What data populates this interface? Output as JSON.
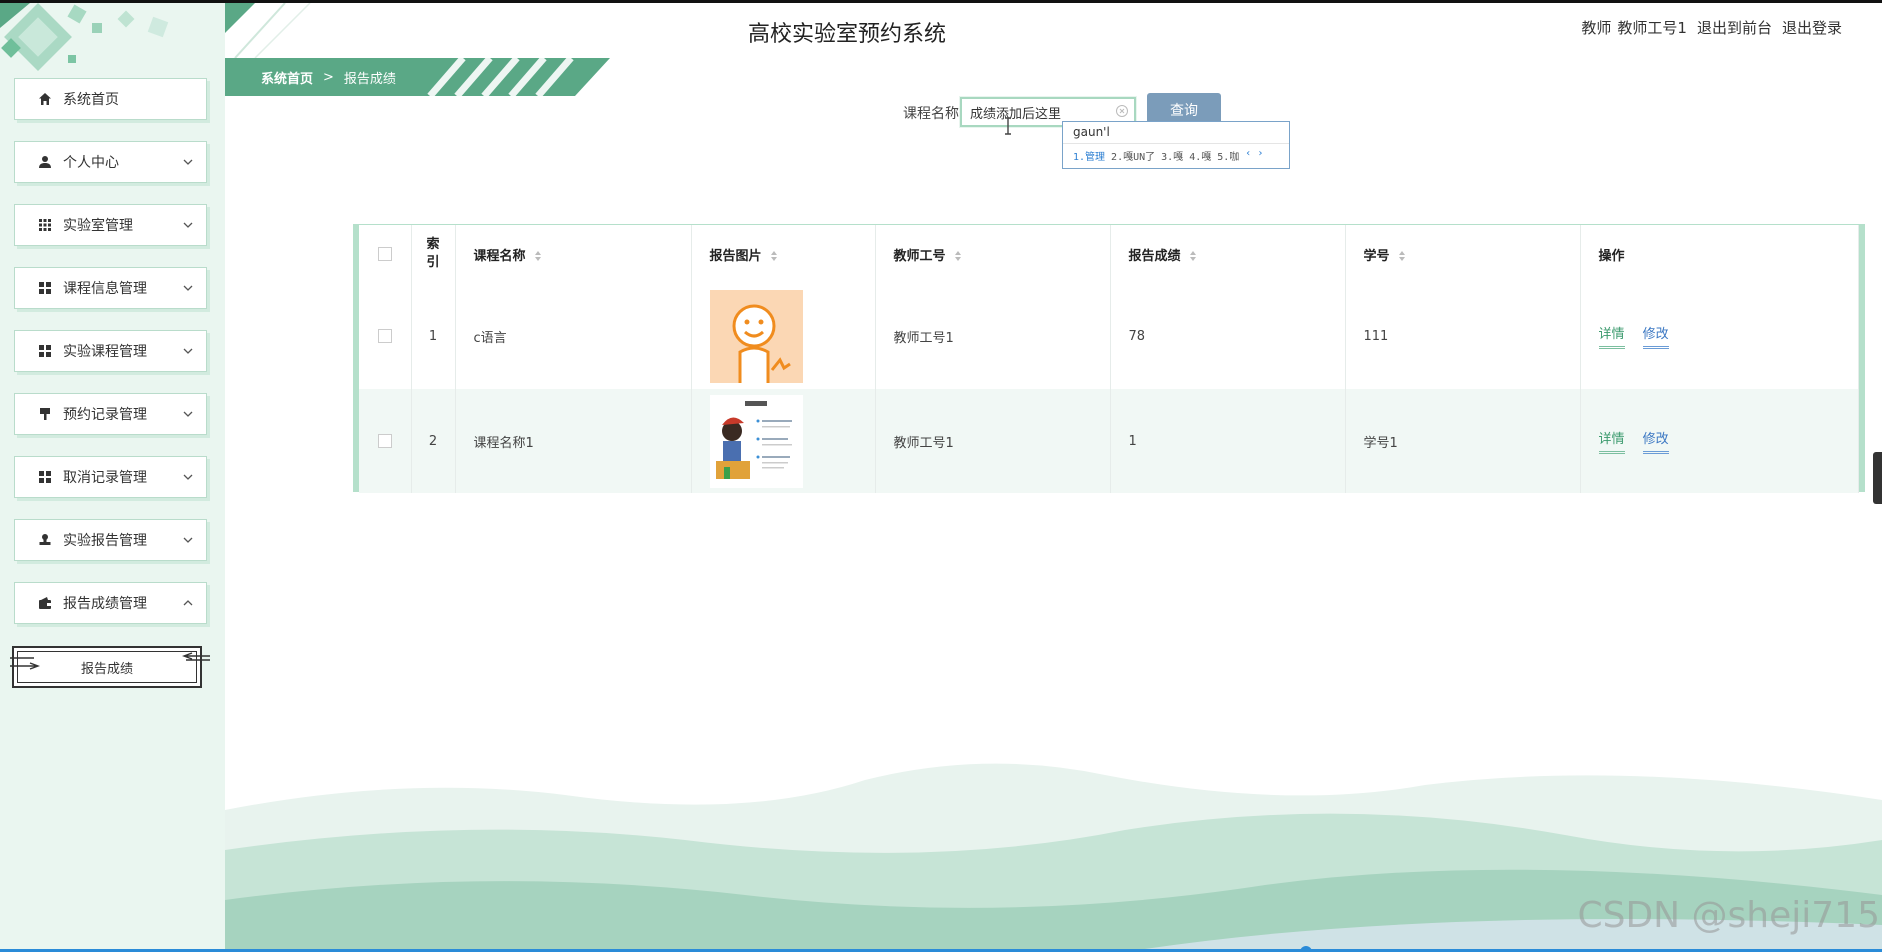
{
  "header": {
    "title": "高校实验室预约系统",
    "user_role": "教师",
    "user_name": "教师工号1",
    "to_front": "退出到前台",
    "logout": "退出登录"
  },
  "sidebar": {
    "items": [
      {
        "label": "系统首页",
        "icon": "home-icon"
      },
      {
        "label": "个人中心",
        "icon": "user-icon"
      },
      {
        "label": "实验室管理",
        "icon": "grid-icon"
      },
      {
        "label": "课程信息管理",
        "icon": "apps-icon"
      },
      {
        "label": "实验课程管理",
        "icon": "apps-icon"
      },
      {
        "label": "预约记录管理",
        "icon": "brush-icon"
      },
      {
        "label": "取消记录管理",
        "icon": "apps-icon"
      },
      {
        "label": "实验报告管理",
        "icon": "stamp-icon"
      },
      {
        "label": "报告成绩管理",
        "icon": "wallet-icon"
      }
    ],
    "sub_item": "报告成绩"
  },
  "breadcrumb": {
    "home": "系统首页",
    "separator": ">",
    "current": "报告成绩"
  },
  "search": {
    "label": "课程名称",
    "value": "成绩添加后这里",
    "button": "查询"
  },
  "ime": {
    "composition": "gaun'l",
    "candidates": [
      "1.管理",
      "2.嘎UN了",
      "3.嘎",
      "4.嘎",
      "5.咖"
    ]
  },
  "table": {
    "headers": {
      "index": "索引",
      "course": "课程名称",
      "image": "报告图片",
      "teacher": "教师工号",
      "score": "报告成绩",
      "student": "学号",
      "ops": "操作"
    },
    "rows": [
      {
        "index": "1",
        "course": "c语言",
        "teacher": "教师工号1",
        "score": "78",
        "student": "111"
      },
      {
        "index": "2",
        "course": "课程名称1",
        "teacher": "教师工号1",
        "score": "1",
        "student": "学号1"
      }
    ],
    "detail": "详情",
    "edit": "修改"
  },
  "watermark": "CSDN @sheji715",
  "colors": {
    "sidebar_bg": "#eaf6f0",
    "accent_green": "#5aa886",
    "search_button": "#7b9cba"
  }
}
